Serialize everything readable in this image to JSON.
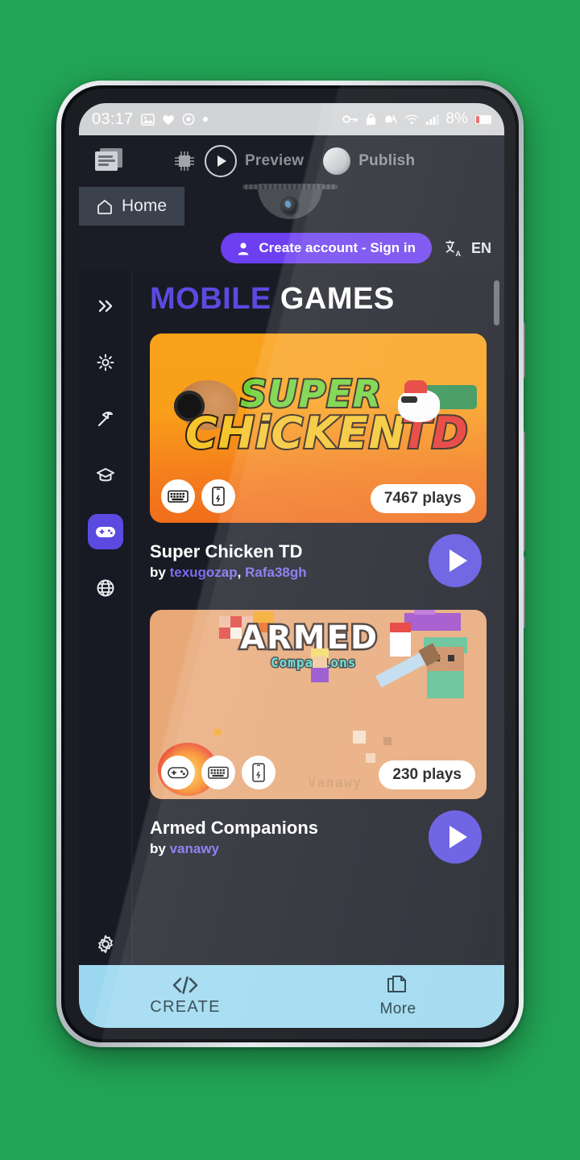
{
  "status_bar": {
    "time": "03:17",
    "left_icons": [
      "image-icon",
      "heart-icon",
      "alarm-icon",
      "dot-icon"
    ],
    "right_icons": [
      "key-icon",
      "lock-icon",
      "bell-muted-icon",
      "wifi-icon",
      "signal-icon"
    ],
    "battery_percent": "8%"
  },
  "appbar": {
    "windows_icon": "windows-stack-icon",
    "chip_icon": "chip-icon",
    "preview_label": "Preview",
    "publish_label": "Publish",
    "play_icon": "play-icon",
    "publish_icon": "disc-icon"
  },
  "tabs": {
    "home_label": "Home",
    "home_icon": "home-icon"
  },
  "account": {
    "signin_label": "Create account - Sign in",
    "user_icon": "user-icon",
    "language_code": "EN",
    "translate_icon": "translate-icon",
    "accent_color": "#6c3ff0"
  },
  "sidebar": {
    "items": [
      {
        "name": "expand",
        "icon": "chevrons-right-icon",
        "active": false
      },
      {
        "name": "effects",
        "icon": "sun-sparkle-icon",
        "active": false
      },
      {
        "name": "build",
        "icon": "pickaxe-icon",
        "active": false
      },
      {
        "name": "learn",
        "icon": "graduation-cap-icon",
        "active": false
      },
      {
        "name": "games",
        "icon": "gamepad-icon",
        "active": true
      },
      {
        "name": "community",
        "icon": "globe-icon",
        "active": false
      }
    ],
    "bottom_items": [
      {
        "name": "settings",
        "icon": "gear-icon"
      },
      {
        "name": "gdevelop-logo",
        "icon": "g-logo-icon"
      }
    ],
    "active_color": "#5b4ae0"
  },
  "main": {
    "title_part1": "MOBILE",
    "title_part2": "GAMES",
    "title_color1": "#5b4ae0",
    "title_color2": "#ffffff",
    "games": [
      {
        "title": "Super Chicken TD",
        "by_label": "by",
        "authors": [
          "texugozap",
          "Rafa38gh"
        ],
        "author_separator": ", ",
        "plays": "7467 plays",
        "platform_icons": [
          "keyboard-icon",
          "mobile-icon"
        ],
        "art": {
          "word1": "SUPER",
          "word2": "CHiCKEN",
          "word3": "TD"
        }
      },
      {
        "title": "Armed Companions",
        "by_label": "by",
        "authors": [
          "vanawy"
        ],
        "author_separator": ", ",
        "plays": "230 plays",
        "platform_icons": [
          "gamepad-icon",
          "keyboard-icon",
          "mobile-icon"
        ],
        "art": {
          "word1": "ARMED",
          "word2": "Companions",
          "watermark": "Vanawy"
        }
      }
    ],
    "play_button_color": "#5b50e0",
    "author_link_color": "#7a6bf0"
  },
  "bottom_bar": {
    "background": "#9bd8ef",
    "items": [
      {
        "label": "CREATE",
        "icon": "code-icon"
      },
      {
        "label": "More",
        "icon": "copy-pages-icon"
      }
    ]
  },
  "page_background": "#22a555"
}
